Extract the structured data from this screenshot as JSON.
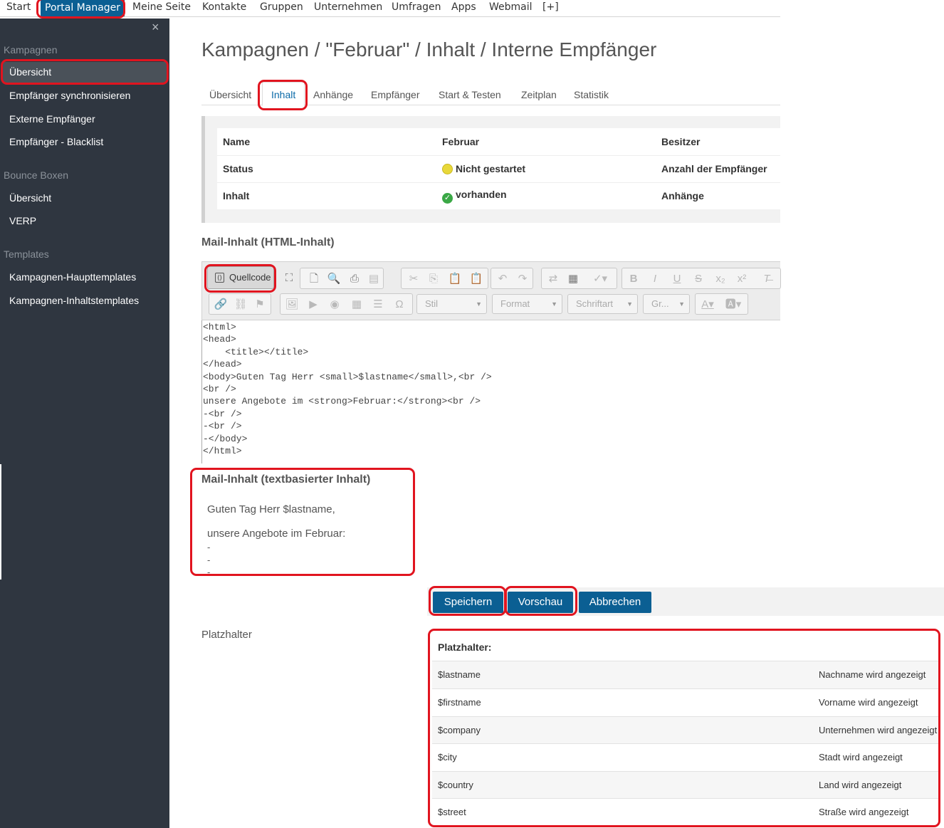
{
  "topnav": {
    "items": [
      "Start",
      "Portal Manager",
      "Meine Seite",
      "Kontakte",
      "Gruppen",
      "Unternehmen",
      "Umfragen",
      "Apps",
      "Webmail",
      "[+]"
    ]
  },
  "sidebar": {
    "close": "×",
    "sections": [
      {
        "title": "Kampagnen",
        "items": [
          "Übersicht",
          "Empfänger synchronisieren",
          "Externe Empfänger",
          "Empfänger - Blacklist"
        ]
      },
      {
        "title": "Bounce Boxen",
        "items": [
          "Übersicht",
          "VERP"
        ]
      },
      {
        "title": "Templates",
        "items": [
          "Kampagnen-Haupttemplates",
          "Kampagnen-Inhaltstemplates"
        ]
      }
    ]
  },
  "page_title": "Kampagnen / \"Februar\" / Inhalt / Interne Empfänger",
  "tabs": [
    "Übersicht",
    "Inhalt",
    "Anhänge",
    "Empfänger",
    "Start & Testen",
    "Zeitplan",
    "Statistik"
  ],
  "info": {
    "rows": [
      [
        "Name",
        "Februar",
        "Besitzer"
      ],
      [
        "Status",
        "Nicht gestartet",
        "Anzahl der Empfänger"
      ],
      [
        "Inhalt",
        "vorhanden",
        "Anhänge"
      ]
    ]
  },
  "html_section_title": "Mail-Inhalt (HTML-Inhalt)",
  "editor": {
    "source_button": "Quellcode",
    "combos": [
      "Stil",
      "Format",
      "Schriftart",
      "Gr..."
    ],
    "source_lines": [
      "<html>",
      "<head>",
      "    <title></title>",
      "</head>",
      "<body>Guten Tag Herr <small>$lastname</small>,<br />",
      "<br />",
      "unsere Angebote im <strong>Februar:</strong><br />",
      "-<br />",
      "-<br />",
      "-</body>",
      "</html>"
    ]
  },
  "text_section_title": "Mail-Inhalt (textbasierter Inhalt)",
  "text_content": {
    "greeting": "Guten Tag Herr $lastname,",
    "offer": "unsere Angebote im Februar:",
    "dashes": [
      "-",
      "-",
      "-"
    ]
  },
  "buttons": {
    "save": "Speichern",
    "preview": "Vorschau",
    "cancel": "Abbrechen"
  },
  "placeholder_label": "Platzhalter",
  "placeholders": {
    "header": "Platzhalter:",
    "rows": [
      {
        "key": "$lastname",
        "desc": "Nachname wird angezeigt"
      },
      {
        "key": "$firstname",
        "desc": "Vorname wird angezeigt"
      },
      {
        "key": "$company",
        "desc": "Unternehmen wird angezeigt"
      },
      {
        "key": "$city",
        "desc": "Stadt wird angezeigt"
      },
      {
        "key": "$country",
        "desc": "Land wird angezeigt"
      },
      {
        "key": "$street",
        "desc": "Straße wird angezeigt"
      }
    ]
  },
  "colors": {
    "accent": "#0b5f93",
    "sidebar": "#2f3640",
    "annotation": "#e1141f"
  }
}
